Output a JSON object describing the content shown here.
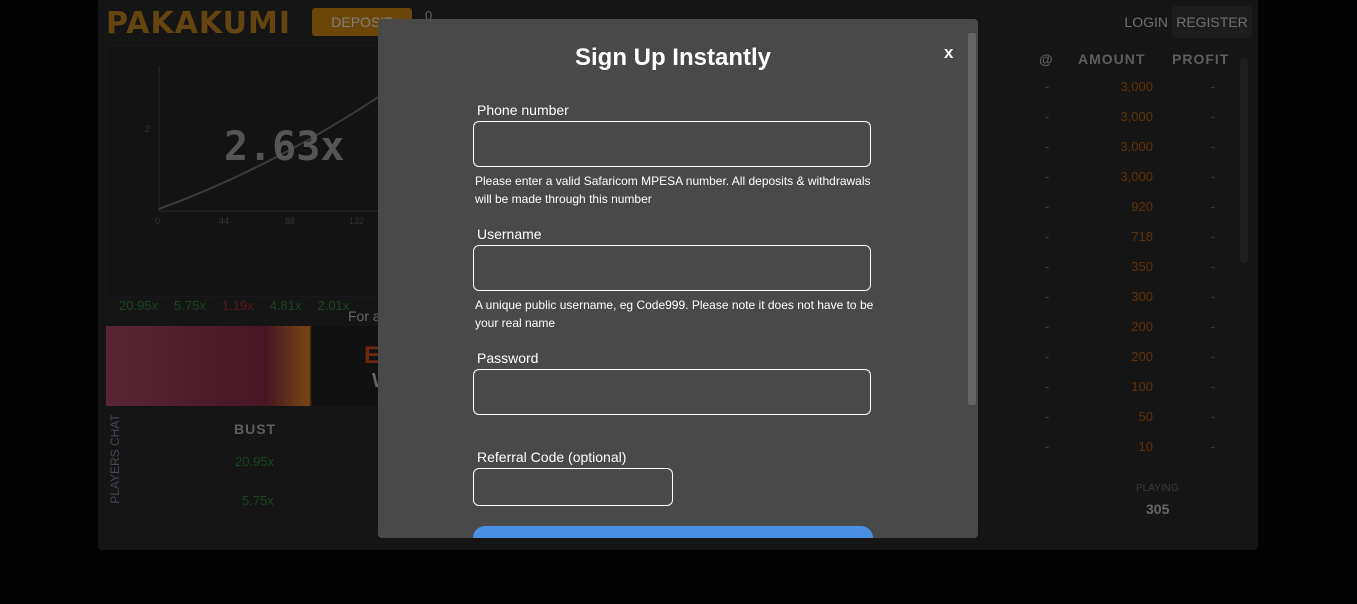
{
  "header": {
    "logo": "PAKAKUMI",
    "deposit_label": "DEPOSIT",
    "balance": "0",
    "login_label": "LOGIN",
    "register_label": "REGISTER"
  },
  "game": {
    "multiplier": "2.63x",
    "history": [
      {
        "value": "20.95x",
        "color": "#2e8b3a"
      },
      {
        "value": "5.75x",
        "color": "#2e8b3a"
      },
      {
        "value": "1.19x",
        "color": "#aa3333"
      },
      {
        "value": "4.81x",
        "color": "#2e8b3a"
      },
      {
        "value": "2.01x",
        "color": "#2e8b3a"
      }
    ],
    "axis_y_tick": "2",
    "axis_x_ticks": [
      "0",
      "44",
      "88",
      "132"
    ]
  },
  "ad": {
    "text": "For a",
    "banner_text_1": "EL",
    "banner_text_2": "W"
  },
  "bust_table": {
    "side_tab": "PLAYERS CHAT",
    "header": "BUST",
    "values": [
      "20.95x",
      "5.75x"
    ]
  },
  "players_table": {
    "headers": {
      "at": "@",
      "amount": "AMOUNT",
      "profit": "PROFIT"
    },
    "rows": [
      {
        "at": "-",
        "amount": "3,000",
        "profit": "-"
      },
      {
        "at": "-",
        "amount": "3,000",
        "profit": "-"
      },
      {
        "at": "-",
        "amount": "3,000",
        "profit": "-"
      },
      {
        "at": "-",
        "amount": "3,000",
        "profit": "-"
      },
      {
        "at": "-",
        "amount": "920",
        "profit": "-"
      },
      {
        "at": "-",
        "amount": "718",
        "profit": "-"
      },
      {
        "at": "-",
        "amount": "350",
        "profit": "-"
      },
      {
        "at": "-",
        "amount": "300",
        "profit": "-"
      },
      {
        "at": "-",
        "amount": "200",
        "profit": "-"
      },
      {
        "at": "-",
        "amount": "200",
        "profit": "-"
      },
      {
        "at": "-",
        "amount": "100",
        "profit": "-"
      },
      {
        "at": "-",
        "amount": "50",
        "profit": "-"
      },
      {
        "at": "-",
        "amount": "10",
        "profit": "-"
      }
    ],
    "playing_label": "PLAYING",
    "playing_count": "305"
  },
  "modal": {
    "title": "Sign Up Instantly",
    "close_label": "x",
    "phone": {
      "label": "Phone number",
      "value": "",
      "help": "Please enter a valid Safaricom MPESA number. All deposits & withdrawals will be made through this number"
    },
    "username": {
      "label": "Username",
      "value": "",
      "help": "A unique public username, eg Code999. Please note it does not have to be your real name"
    },
    "password": {
      "label": "Password",
      "value": ""
    },
    "referral": {
      "label": "Referral Code (optional)",
      "value": ""
    }
  },
  "colors": {
    "accent": "#d98b11",
    "modal_bg": "#494949",
    "submit": "#4a90e2"
  }
}
